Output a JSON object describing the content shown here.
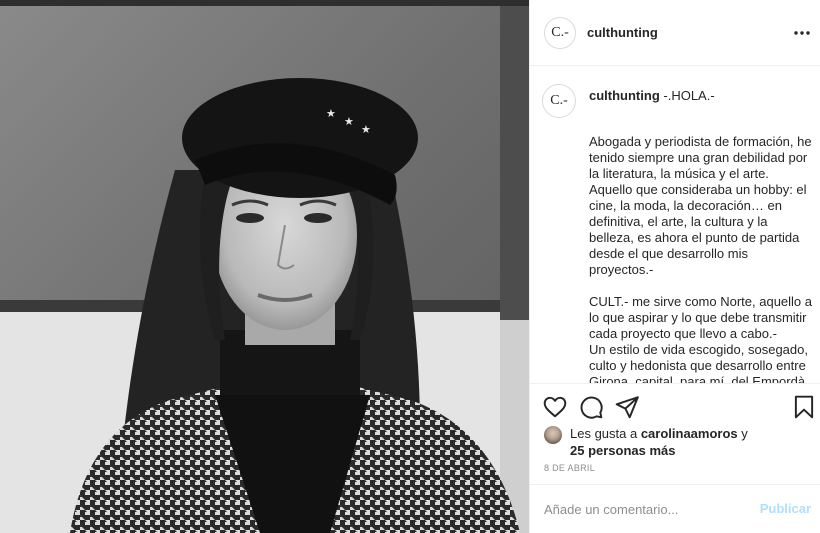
{
  "post": {
    "image_alt": "Black and white portrait of a woman wearing a beret and a houndstooth coat"
  },
  "header": {
    "avatar_text": "C.-",
    "username": "culthunting",
    "more_glyph": "•••"
  },
  "caption": {
    "avatar_text": "C.-",
    "username": "culthunting",
    "headline": " -.HOLA.-",
    "paragraph1": "Abogada y periodista de formación, he tenido siempre una gran debilidad por la literatura, la música y el arte. Aquello que consideraba un hobby: el cine, la moda, la decoración… en definitiva, el arte, la cultura y la belleza, es ahora el punto de partida desde el que desarrollo mis proyectos.-",
    "paragraph2": "CULT.- me sirve como Norte, aquello a lo que aspirar y lo que debe transmitir cada proyecto que llevo a cabo.-",
    "paragraph3": "Un estilo de vida escogido, sosegado, culto y hedonista que desarrollo entre Girona, capital, para mí, del Empordà, y Sant Feliu de Guíxols."
  },
  "actions": {
    "like_icon": "heart-icon",
    "comment_icon": "comment-icon",
    "share_icon": "paper-plane-icon",
    "save_icon": "bookmark-icon"
  },
  "likes": {
    "prefix": "Les gusta a ",
    "user": "carolinaamoros",
    "connector": " y",
    "others": "25 personas más"
  },
  "date": "8 DE ABRIL",
  "comment": {
    "placeholder": "Añade un comentario...",
    "publish_label": "Publicar"
  },
  "colors": {
    "text": "#262626",
    "muted": "#8e8e8e",
    "border": "#efefef",
    "publish_disabled": "#b2dffc"
  }
}
